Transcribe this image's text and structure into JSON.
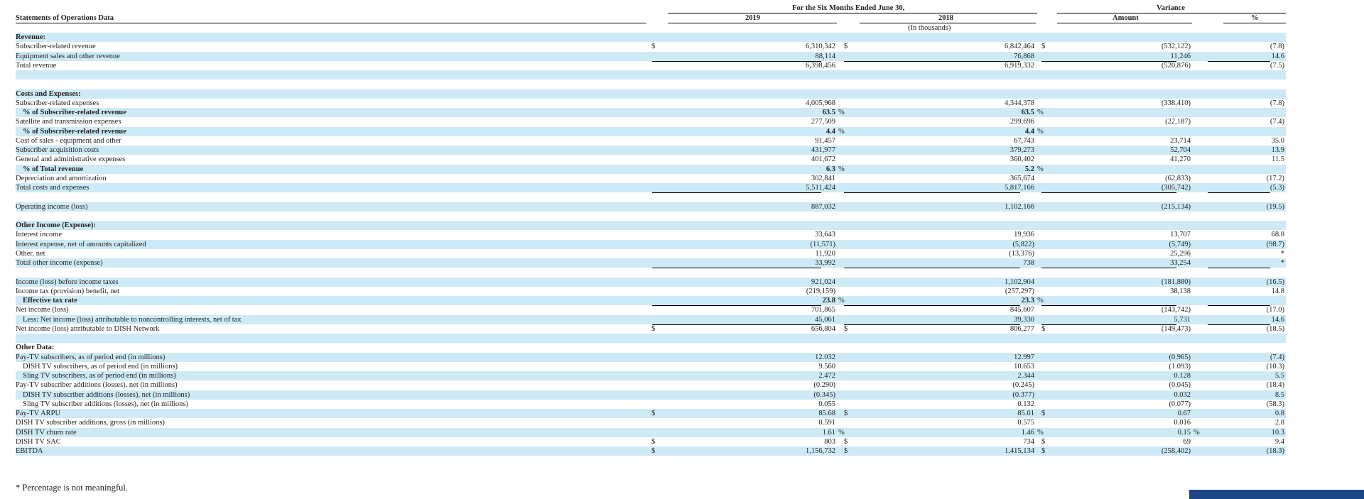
{
  "header": {
    "statement_title": "Statements of Operations Data",
    "period_heading": "For the Six Months Ended June 30,",
    "variance_heading": "Variance",
    "col_2019": "2019",
    "col_2018": "2018",
    "col_amount": "Amount",
    "col_pct": "%",
    "units_note": "(In thousands)"
  },
  "rows": [
    {
      "label": "Revenue:",
      "style": "bold",
      "shaded": true
    },
    {
      "label": "Subscriber-related revenue",
      "shaded": false,
      "c1": "$",
      "v2019": "6,310,342",
      "c2": "$",
      "v2018": "6,842,464",
      "c3": "$",
      "amount": "(532,122)",
      "pct": "(7.8)"
    },
    {
      "label": "Equipment sales and other revenue",
      "shaded": true,
      "v2019": "88,114",
      "v2018": "76,868",
      "amount": "11,246",
      "pct": "14.6",
      "ul": true
    },
    {
      "label": "Total revenue",
      "shaded": false,
      "v2019": "6,398,456",
      "v2018": "6,919,332",
      "amount": "(520,876)",
      "pct": "(7.5)",
      "ul": true
    },
    {
      "label": "",
      "shaded": true
    },
    {
      "label": "",
      "shaded": false
    },
    {
      "label": "Costs and Expenses:",
      "style": "bold",
      "shaded": true
    },
    {
      "label": "Subscriber-related expenses",
      "shaded": false,
      "v2019": "4,005,968",
      "v2018": "4,344,378",
      "amount": "(338,410)",
      "pct": "(7.8)"
    },
    {
      "label": "% of Subscriber-related revenue",
      "style": "boldindent",
      "shaded": true,
      "bold_vals": true,
      "v2019": "63.5",
      "s2019": "%",
      "v2018": "63.5",
      "s2018": "%"
    },
    {
      "label": "Satellite and transmission expenses",
      "shaded": false,
      "v2019": "277,509",
      "v2018": "299,696",
      "amount": "(22,187)",
      "pct": "(7.4)"
    },
    {
      "label": "% of Subscriber-related revenue",
      "style": "boldindent",
      "shaded": true,
      "bold_vals": true,
      "v2019": "4.4",
      "s2019": "%",
      "v2018": "4.4",
      "s2018": "%"
    },
    {
      "label": "Cost of sales - equipment and other",
      "shaded": false,
      "v2019": "91,457",
      "v2018": "67,743",
      "amount": "23,714",
      "pct": "35.0"
    },
    {
      "label": "Subscriber acquisition costs",
      "shaded": true,
      "v2019": "431,977",
      "v2018": "379,273",
      "amount": "52,704",
      "pct": "13.9"
    },
    {
      "label": "General and administrative expenses",
      "shaded": false,
      "v2019": "401,672",
      "v2018": "360,402",
      "amount": "41,270",
      "pct": "11.5"
    },
    {
      "label": "% of Total revenue",
      "style": "boldindent",
      "shaded": true,
      "bold_vals": true,
      "v2019": "6.3",
      "s2019": "%",
      "v2018": "5.2",
      "s2018": "%"
    },
    {
      "label": "Depreciation and amortization",
      "shaded": false,
      "v2019": "302,841",
      "v2018": "365,674",
      "amount": "(62,833)",
      "pct": "(17.2)",
      "ul": true
    },
    {
      "label": "Total costs and expenses",
      "shaded": true,
      "v2019": "5,511,424",
      "v2018": "5,817,166",
      "amount": "(305,742)",
      "pct": "(5.3)",
      "ul": true
    },
    {
      "label": "",
      "shaded": false
    },
    {
      "label": "Operating income (loss)",
      "shaded": true,
      "v2019": "887,032",
      "v2018": "1,102,166",
      "amount": "(215,134)",
      "pct": "(19.5)"
    },
    {
      "label": "",
      "shaded": false
    },
    {
      "label": "Other Income (Expense):",
      "style": "bold",
      "shaded": true
    },
    {
      "label": "Interest income",
      "shaded": false,
      "v2019": "33,643",
      "v2018": "19,936",
      "amount": "13,707",
      "pct": "68.8"
    },
    {
      "label": "Interest expense, net of amounts capitalized",
      "shaded": true,
      "v2019": "(11,571)",
      "v2018": "(5,822)",
      "amount": "(5,749)",
      "pct": "(98.7)"
    },
    {
      "label": "Other, net",
      "shaded": false,
      "v2019": "11,920",
      "v2018": "(13,376)",
      "amount": "25,296",
      "pct": "*",
      "ul": true
    },
    {
      "label": "Total other income (expense)",
      "shaded": true,
      "v2019": "33,992",
      "v2018": "738",
      "amount": "33,254",
      "pct": "*",
      "ul": true
    },
    {
      "label": "",
      "shaded": false
    },
    {
      "label": "Income (loss) before income taxes",
      "shaded": true,
      "v2019": "921,024",
      "v2018": "1,102,904",
      "amount": "(181,880)",
      "pct": "(16.5)"
    },
    {
      "label": "Income tax (provision) benefit, net",
      "shaded": false,
      "v2019": "(219,159)",
      "v2018": "(257,297)",
      "amount": "38,138",
      "pct": "14.8"
    },
    {
      "label": "Effective tax rate",
      "style": "boldindent",
      "shaded": true,
      "bold_vals": true,
      "v2019": "23.8",
      "s2019": "%",
      "v2018": "23.3",
      "s2018": "%",
      "ul": true
    },
    {
      "label": "Net income (loss)",
      "shaded": false,
      "v2019": "701,865",
      "v2018": "845,607",
      "amount": "(143,742)",
      "pct": "(17.0)"
    },
    {
      "label": "Less: Net income (loss) attributable to noncontrolling interests, net of tax",
      "style": "indent",
      "shaded": true,
      "v2019": "45,061",
      "v2018": "39,330",
      "amount": "5,731",
      "pct": "14.6",
      "ul": true
    },
    {
      "label": "Net income (loss) attributable to DISH Network",
      "shaded": false,
      "c1": "$",
      "v2019": "656,804",
      "c2": "$",
      "v2018": "806,277",
      "c3": "$",
      "amount": "(149,473)",
      "pct": "(18.5)",
      "dul": true
    },
    {
      "label": "",
      "shaded": true
    },
    {
      "label": "Other Data:",
      "style": "bold",
      "shaded": false
    },
    {
      "label": "Pay-TV subscribers, as of period end (in millions)",
      "shaded": true,
      "v2019": "12.032",
      "v2018": "12.997",
      "amount": "(0.965)",
      "pct": "(7.4)"
    },
    {
      "label": "DISH TV subscribers, as of period end (in millions)",
      "style": "indent",
      "shaded": false,
      "v2019": "9.560",
      "v2018": "10.653",
      "amount": "(1.093)",
      "pct": "(10.3)"
    },
    {
      "label": "Sling TV subscribers, as of period end (in millions)",
      "style": "indent",
      "shaded": true,
      "v2019": "2.472",
      "v2018": "2.344",
      "amount": "0.128",
      "pct": "5.5"
    },
    {
      "label": "Pay-TV subscriber additions (losses), net (in millions)",
      "shaded": false,
      "v2019": "(0.290)",
      "v2018": "(0.245)",
      "amount": "(0.045)",
      "pct": "(18.4)"
    },
    {
      "label": "DISH TV subscriber additions (losses), net (in millions)",
      "style": "indent",
      "shaded": true,
      "v2019": "(0.345)",
      "v2018": "(0.377)",
      "amount": "0.032",
      "pct": "8.5"
    },
    {
      "label": "Sling TV subscriber additions (losses), net (in millions)",
      "style": "indent",
      "shaded": false,
      "v2019": "0.055",
      "v2018": "0.132",
      "amount": "(0.077)",
      "pct": "(58.3)"
    },
    {
      "label": "Pay-TV ARPU",
      "shaded": true,
      "c1": "$",
      "v2019": "85.68",
      "c2": "$",
      "v2018": "85.01",
      "c3": "$",
      "amount": "0.67",
      "pct": "0.8"
    },
    {
      "label": "DISH TV subscriber additions, gross (in millions)",
      "shaded": false,
      "v2019": "0.591",
      "v2018": "0.575",
      "amount": "0.016",
      "pct": "2.8"
    },
    {
      "label": "DISH TV churn rate",
      "shaded": true,
      "v2019": "1.61",
      "s2019": "%",
      "v2018": "1.46",
      "s2018": "%",
      "amount": "0.15",
      "s3": "%",
      "pct": "10.3"
    },
    {
      "label": "DISH TV SAC",
      "shaded": false,
      "c1": "$",
      "v2019": "803",
      "c2": "$",
      "v2018": "734",
      "c3": "$",
      "amount": "69",
      "pct": "9.4"
    },
    {
      "label": "EBITDA",
      "shaded": true,
      "c1": "$",
      "v2019": "1,156,732",
      "c2": "$",
      "v2018": "1,415,134",
      "c3": "$",
      "amount": "(258,402)",
      "pct": "(18.3)"
    },
    {
      "label": "",
      "shaded": false
    }
  ],
  "footnote": "* Percentage is not meaningful."
}
